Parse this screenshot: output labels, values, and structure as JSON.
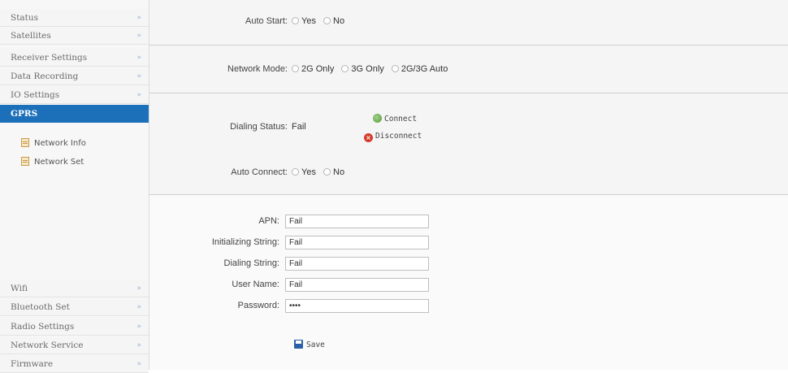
{
  "sidebar": {
    "top_items": [
      {
        "label": "Status"
      },
      {
        "label": "Satellites"
      },
      {
        "label": "Receiver Settings"
      },
      {
        "label": "Data Recording"
      },
      {
        "label": "IO Settings"
      }
    ],
    "active_item": {
      "label": "GPRS"
    },
    "sub_items": [
      {
        "label": "Network Info"
      },
      {
        "label": "Network Set"
      }
    ],
    "bottom_items": [
      {
        "label": "Wifi"
      },
      {
        "label": "Bluetooth Set"
      },
      {
        "label": "Radio Settings"
      },
      {
        "label": "Network Service"
      },
      {
        "label": "Firmware"
      }
    ],
    "chevron": "»"
  },
  "form": {
    "auto_start": {
      "label": "Auto Start:",
      "options": [
        "Yes",
        "No"
      ]
    },
    "network_mode": {
      "label": "Network Mode:",
      "options": [
        "2G Only",
        "3G Only",
        "2G/3G Auto"
      ]
    },
    "dialing_status": {
      "label": "Dialing Status:",
      "value": "Fail"
    },
    "connect_label": "Connect",
    "disconnect_label": "Disconnect",
    "auto_connect": {
      "label": "Auto Connect:",
      "options": [
        "Yes",
        "No"
      ]
    },
    "fields": {
      "apn": {
        "label": "APN:",
        "value": "Fail"
      },
      "init_string": {
        "label": "Initializing String:",
        "value": "Fail"
      },
      "dial_string": {
        "label": "Dialing String:",
        "value": "Fail"
      },
      "user_name": {
        "label": "User Name:",
        "value": "Fail"
      },
      "password": {
        "label": "Password:",
        "value": "••••"
      }
    },
    "save_label": "Save"
  },
  "colors": {
    "accent": "#1c6fb9"
  }
}
